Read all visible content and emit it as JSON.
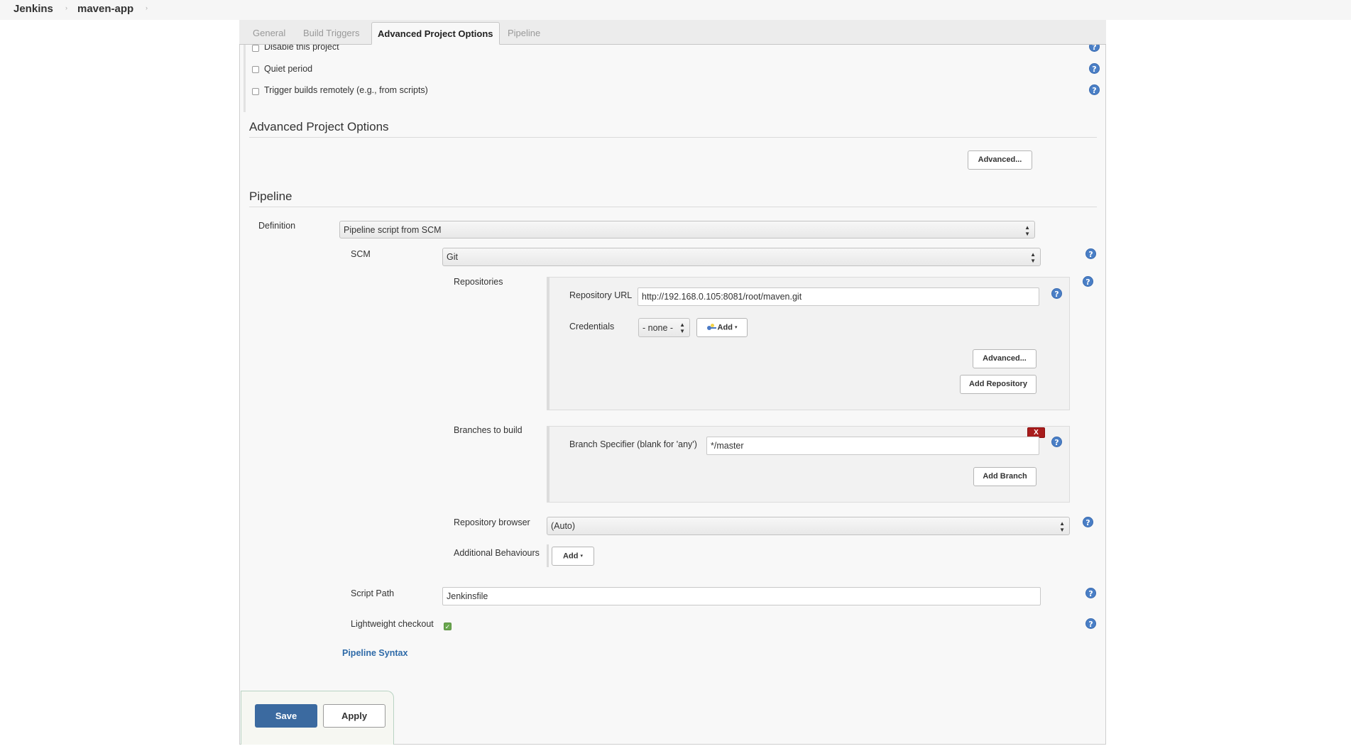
{
  "breadcrumb": {
    "items": [
      "Jenkins",
      "maven-app"
    ],
    "separator": "›"
  },
  "tabs": [
    {
      "label": "General",
      "active": false
    },
    {
      "label": "Build Triggers",
      "active": false
    },
    {
      "label": "Advanced Project Options",
      "active": true
    },
    {
      "label": "Pipeline",
      "active": false
    }
  ],
  "build_triggers": {
    "options": [
      {
        "label": "Disable this project",
        "checked": false
      },
      {
        "label": "Quiet period",
        "checked": false
      },
      {
        "label": "Trigger builds remotely (e.g., from scripts)",
        "checked": false
      }
    ]
  },
  "advanced_project_options": {
    "heading": "Advanced Project Options",
    "advanced_button": "Advanced..."
  },
  "pipeline": {
    "heading": "Pipeline",
    "definition_label": "Definition",
    "definition_value": "Pipeline script from SCM",
    "scm_label": "SCM",
    "scm_value": "Git",
    "repositories_label": "Repositories",
    "repository_url_label": "Repository URL",
    "repository_url_value": "http://192.168.0.105:8081/root/maven.git",
    "credentials_label": "Credentials",
    "credentials_value": "- none -",
    "credentials_add_button": "Add",
    "repo_advanced_button": "Advanced...",
    "add_repository_button": "Add Repository",
    "branches_label": "Branches to build",
    "delete_branch_button": "X",
    "branch_specifier_label": "Branch Specifier (blank for 'any')",
    "branch_specifier_value": "*/master",
    "add_branch_button": "Add Branch",
    "repository_browser_label": "Repository browser",
    "repository_browser_value": "(Auto)",
    "additional_behaviours_label": "Additional Behaviours",
    "additional_behaviours_add_button": "Add",
    "script_path_label": "Script Path",
    "script_path_value": "Jenkinsfile",
    "lightweight_checkout_label": "Lightweight checkout",
    "lightweight_checkout_checked": true,
    "pipeline_syntax_link": "Pipeline Syntax"
  },
  "icons": {
    "help": "?",
    "check": "✓",
    "select_arrows": "▲▼",
    "caret": "▾"
  },
  "footer": {
    "save_button": "Save",
    "apply_button": "Apply"
  },
  "colors": {
    "save_button_bg": "#3b6aa0",
    "help_icon": "#4a7fc6",
    "delete_button": "#a81c1c",
    "link": "#2e6aa8",
    "checkbox_checked": "#6aa84f"
  }
}
